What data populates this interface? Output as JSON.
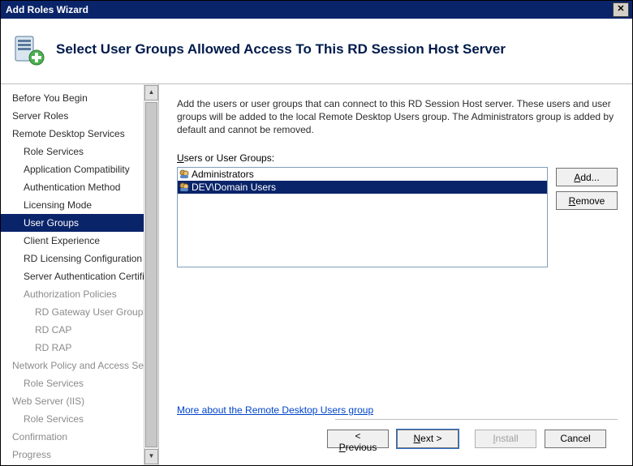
{
  "window": {
    "title": "Add Roles Wizard"
  },
  "header": {
    "title": "Select User Groups Allowed Access To This RD Session Host Server"
  },
  "nav": {
    "items": [
      {
        "label": "Before You Begin",
        "level": 0,
        "selected": false,
        "disabled": false
      },
      {
        "label": "Server Roles",
        "level": 0,
        "selected": false,
        "disabled": false
      },
      {
        "label": "Remote Desktop Services",
        "level": 0,
        "selected": false,
        "disabled": false
      },
      {
        "label": "Role Services",
        "level": 1,
        "selected": false,
        "disabled": false
      },
      {
        "label": "Application Compatibility",
        "level": 1,
        "selected": false,
        "disabled": false
      },
      {
        "label": "Authentication Method",
        "level": 1,
        "selected": false,
        "disabled": false
      },
      {
        "label": "Licensing Mode",
        "level": 1,
        "selected": false,
        "disabled": false
      },
      {
        "label": "User Groups",
        "level": 1,
        "selected": true,
        "disabled": false
      },
      {
        "label": "Client Experience",
        "level": 1,
        "selected": false,
        "disabled": false
      },
      {
        "label": "RD Licensing Configuration",
        "level": 1,
        "selected": false,
        "disabled": false
      },
      {
        "label": "Server Authentication Certificate",
        "level": 1,
        "selected": false,
        "disabled": false
      },
      {
        "label": "Authorization Policies",
        "level": 1,
        "selected": false,
        "disabled": true
      },
      {
        "label": "RD Gateway User Groups",
        "level": 2,
        "selected": false,
        "disabled": true
      },
      {
        "label": "RD CAP",
        "level": 2,
        "selected": false,
        "disabled": true
      },
      {
        "label": "RD RAP",
        "level": 2,
        "selected": false,
        "disabled": true
      },
      {
        "label": "Network Policy and Access Services",
        "level": 0,
        "selected": false,
        "disabled": true
      },
      {
        "label": "Role Services",
        "level": 1,
        "selected": false,
        "disabled": true
      },
      {
        "label": "Web Server (IIS)",
        "level": 0,
        "selected": false,
        "disabled": true
      },
      {
        "label": "Role Services",
        "level": 1,
        "selected": false,
        "disabled": true
      },
      {
        "label": "Confirmation",
        "level": 0,
        "selected": false,
        "disabled": true
      },
      {
        "label": "Progress",
        "level": 0,
        "selected": false,
        "disabled": true
      }
    ]
  },
  "content": {
    "description": "Add the users or user groups that can connect to this RD Session Host server. These users and user groups will be added to the local Remote Desktop Users group. The Administrators group is added by default and cannot be removed.",
    "list_label": "Users or User Groups:",
    "groups": [
      {
        "name": "Administrators",
        "selected": false
      },
      {
        "name": "DEV\\Domain Users",
        "selected": true
      }
    ],
    "add_label": "Add...",
    "remove_label": "Remove",
    "link_text": "More about the Remote Desktop Users group"
  },
  "footer": {
    "previous": "< Previous",
    "next": "Next >",
    "install": "Install",
    "cancel": "Cancel"
  }
}
